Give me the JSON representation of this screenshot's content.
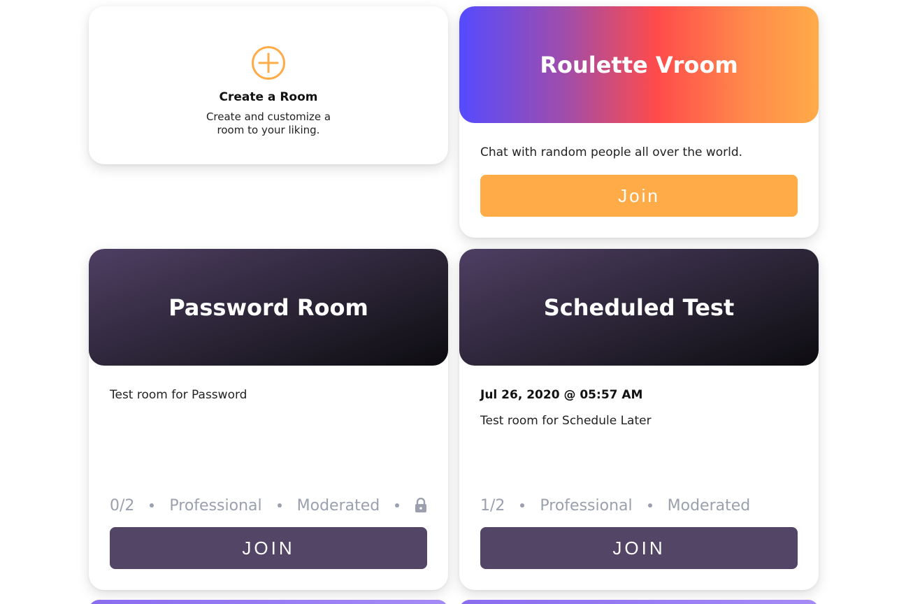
{
  "create_room": {
    "title": "Create a Room",
    "description": "Create and customize a room to your liking.",
    "icon": "plus-circle-icon",
    "accent": "#ffab48"
  },
  "roulette": {
    "title": "Roulette Vroom",
    "description": "Chat with random people all over the world.",
    "join_label": "Join",
    "button_color": "#ffab48"
  },
  "rooms": [
    {
      "title": "Password Room",
      "date": "",
      "description": "Test room for Password",
      "occupancy": "0/2",
      "tier": "Professional",
      "moderation": "Moderated",
      "locked": true,
      "join_label": "JOIN"
    },
    {
      "title": "Scheduled Test",
      "date": "Jul 26, 2020 @ 05:57 AM",
      "description": "Test room for Schedule Later",
      "occupancy": "1/2",
      "tier": "Professional",
      "moderation": "Moderated",
      "locked": false,
      "join_label": "JOIN"
    }
  ],
  "colors": {
    "dark_button": "#524565",
    "meta_text": "#9aa0ad"
  }
}
